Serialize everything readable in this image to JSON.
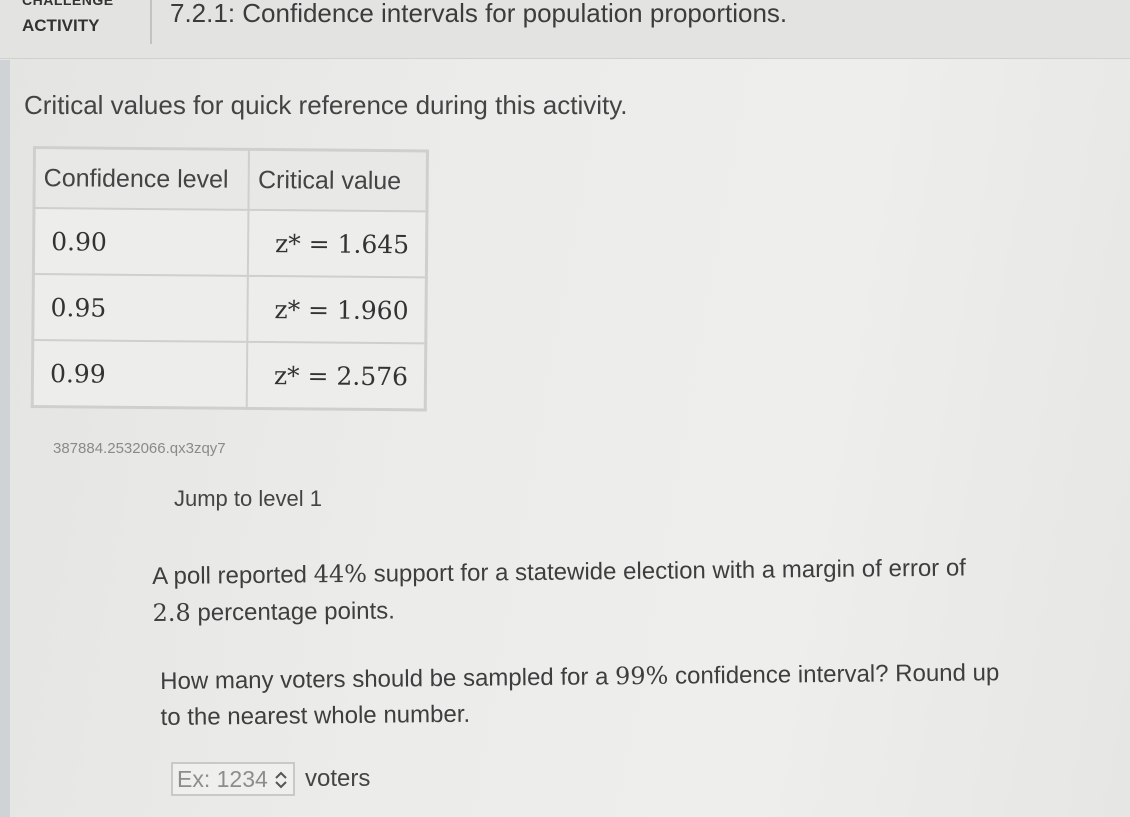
{
  "header": {
    "challenge_label": "CHALLENGE",
    "activity_label": "ACTIVITY",
    "title": "7.2.1: Confidence intervals for population proportions."
  },
  "intro": "Critical values for quick reference during this activity.",
  "reference_table": {
    "headers": [
      "Confidence level",
      "Critical value"
    ],
    "rows": [
      {
        "level": "0.90",
        "critical": "z* = 1.645"
      },
      {
        "level": "0.95",
        "critical": "z* = 1.960"
      },
      {
        "level": "0.99",
        "critical": "z* = 2.576"
      }
    ]
  },
  "reference_id": "387884.2532066.qx3zqy7",
  "jump_link": "Jump to level 1",
  "problem": {
    "part1": "A poll reported ",
    "percent": "44%",
    "part2": " support for a statewide election with a margin of error of",
    "margin": "2.8",
    "part3": " percentage points."
  },
  "question": {
    "part1": "How many voters should be sampled for a ",
    "percent": "99%",
    "part2": " confidence interval? Round up",
    "part3": "to the nearest whole number."
  },
  "answer": {
    "placeholder": "Ex: 1234",
    "value": "",
    "unit": "voters",
    "stepper_icon": "up-down-arrows-icon"
  }
}
